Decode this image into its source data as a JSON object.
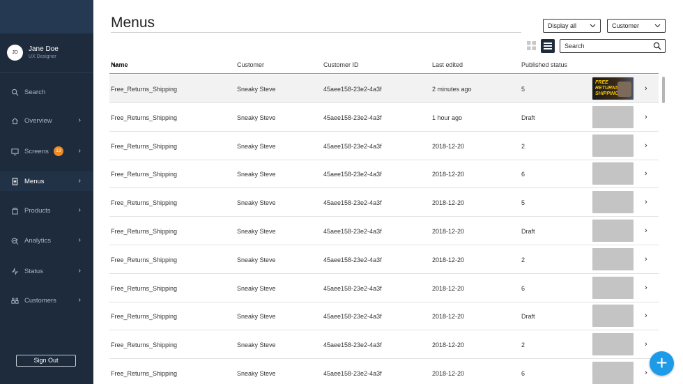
{
  "sidebar": {
    "user": {
      "initials": "JD",
      "name": "Jane Doe",
      "role": "UX Designer"
    },
    "items": [
      {
        "label": "Search",
        "icon": "search-icon"
      },
      {
        "label": "Overview",
        "icon": "home-icon"
      },
      {
        "label": "Screens",
        "icon": "monitor-icon",
        "badge": "13"
      },
      {
        "label": "Menus",
        "icon": "menu-card-icon"
      },
      {
        "label": "Products",
        "icon": "bag-icon"
      },
      {
        "label": "Analytics",
        "icon": "analytics-icon"
      },
      {
        "label": "Status",
        "icon": "pulse-icon"
      },
      {
        "label": "Customers",
        "icon": "customers-icon"
      }
    ],
    "signout_label": "Sign Out",
    "colors": {
      "background": "#1d2b3c",
      "badge": "#f08a24"
    }
  },
  "main": {
    "title": "Menus",
    "display_select": "Display all",
    "customer_select": "Customer",
    "search_placeholder": "Search",
    "columns": [
      "Name",
      "Customer",
      "Customer ID",
      "Last edited",
      "Published status"
    ],
    "rows": [
      {
        "name": "Free_Returns_Shipping",
        "customer": "Sneaky Steve",
        "customer_id": "45aee158-23e2-4a3f",
        "last_edited": "2 minutes ago",
        "status": "5",
        "thumb_text": "FREE RETURNS SHIPPING"
      },
      {
        "name": "Free_Returns_Shipping",
        "customer": "Sneaky Steve",
        "customer_id": "45aee158-23e2-4a3f",
        "last_edited": "1 hour ago",
        "status": "Draft"
      },
      {
        "name": "Free_Returns_Shipping",
        "customer": "Sneaky Steve",
        "customer_id": "45aee158-23e2-4a3f",
        "last_edited": "2018-12-20",
        "status": "2"
      },
      {
        "name": "Free_Returns_Shipping",
        "customer": "Sneaky Steve",
        "customer_id": "45aee158-23e2-4a3f",
        "last_edited": "2018-12-20",
        "status": "6"
      },
      {
        "name": "Free_Returns_Shipping",
        "customer": "Sneaky Steve",
        "customer_id": "45aee158-23e2-4a3f",
        "last_edited": "2018-12-20",
        "status": "5"
      },
      {
        "name": "Free_Returns_Shipping",
        "customer": "Sneaky Steve",
        "customer_id": "45aee158-23e2-4a3f",
        "last_edited": "2018-12-20",
        "status": "Draft"
      },
      {
        "name": "Free_Returns_Shipping",
        "customer": "Sneaky Steve",
        "customer_id": "45aee158-23e2-4a3f",
        "last_edited": "2018-12-20",
        "status": "2"
      },
      {
        "name": "Free_Returns_Shipping",
        "customer": "Sneaky Steve",
        "customer_id": "45aee158-23e2-4a3f",
        "last_edited": "2018-12-20",
        "status": "6"
      },
      {
        "name": "Free_Returns_Shipping",
        "customer": "Sneaky Steve",
        "customer_id": "45aee158-23e2-4a3f",
        "last_edited": "2018-12-20",
        "status": "Draft"
      },
      {
        "name": "Free_Returns_Shipping",
        "customer": "Sneaky Steve",
        "customer_id": "45aee158-23e2-4a3f",
        "last_edited": "2018-12-20",
        "status": "2"
      },
      {
        "name": "Free_Returns_Shipping",
        "customer": "Sneaky Steve",
        "customer_id": "45aee158-23e2-4a3f",
        "last_edited": "2018-12-20",
        "status": "6"
      }
    ],
    "colors": {
      "fab": "#1e9be8",
      "thumb_placeholder": "#c4c4c4"
    }
  }
}
